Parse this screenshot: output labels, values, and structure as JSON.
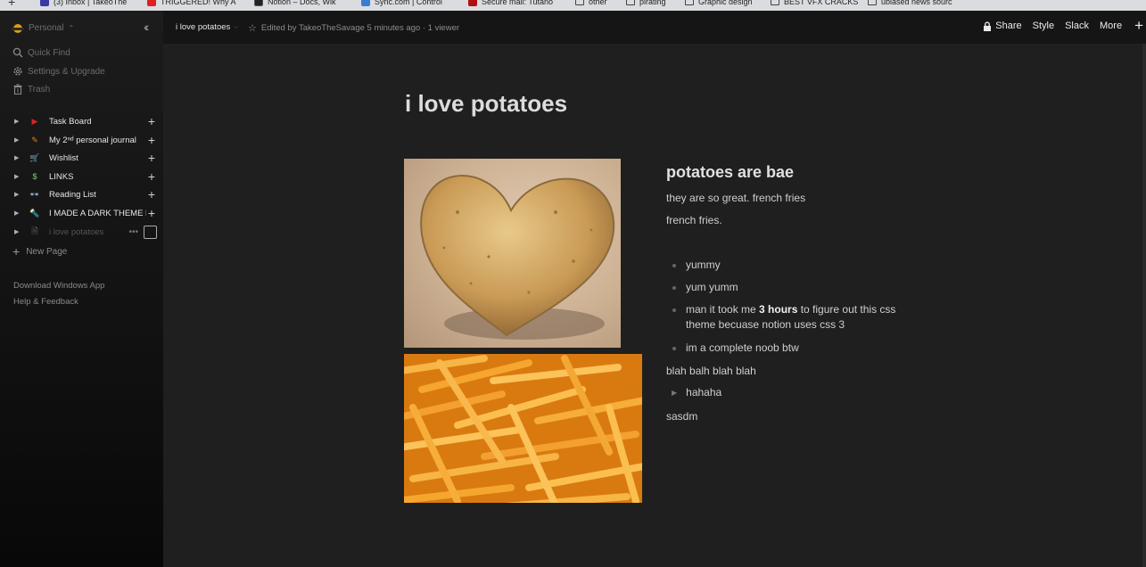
{
  "bookmarks": [
    {
      "label": "(3) Inbox | TakeoThe",
      "color": "#3a3aa0"
    },
    {
      "label": "TRIGGERED! Why A",
      "color": "#e02020"
    },
    {
      "label": "Notion – Docs, Wik",
      "color": "#222222"
    },
    {
      "label": "Sync.com | Control",
      "color": "#3a7bd5"
    },
    {
      "label": "Secure mail: Tutano",
      "color": "#b01010"
    },
    {
      "label": "other",
      "folder": true
    },
    {
      "label": "pirating",
      "folder": true
    },
    {
      "label": "Graphic design",
      "folder": true
    },
    {
      "label": "BEST VFX CRACKS",
      "folder": true
    },
    {
      "label": "ubiased news sourc",
      "folder": true
    }
  ],
  "sidebar": {
    "workspace": "Personal",
    "workspace_caret": "⌃",
    "nav": [
      {
        "label": "Quick Find",
        "icon": "search-icon"
      },
      {
        "label": "Settings & Upgrade",
        "icon": "gear-icon"
      },
      {
        "label": "Trash",
        "icon": "trash-icon"
      }
    ],
    "pages": [
      {
        "label": "Task Board",
        "icon": "▶",
        "icon_color": "#e02020"
      },
      {
        "label": "My 2ⁿᵈ personal journal",
        "icon": "✎",
        "icon_color": "#e0812a"
      },
      {
        "label": "Wishlist",
        "icon": "🛒",
        "icon_color": "#cccccc"
      },
      {
        "label": "LINKS",
        "icon": "$",
        "icon_color": "#7fcf6a"
      },
      {
        "label": "Reading List",
        "icon": "👓",
        "icon_color": "#4aa8e0"
      },
      {
        "label": "I MADE A DARK THEME F",
        "icon": "🔦",
        "icon_color": "#e0c04a"
      },
      {
        "label": "i love potatoes",
        "icon": "🗎",
        "icon_color": "#888888"
      }
    ],
    "new_page": "New Page",
    "footer": [
      "Download Windows App",
      "Help & Feedback"
    ]
  },
  "topbar": {
    "breadcrumb": "i love potatoes",
    "edited": "Edited by TakeoTheSavage 5 minutes ago · 1 viewer",
    "share": "Share",
    "style": "Style",
    "slack": "Slack",
    "more": "More"
  },
  "content": {
    "title": "i love potatoes",
    "heading": "potatoes are bae",
    "para1": "they are so great. french fries",
    "para2": "french fries.",
    "bullets": [
      {
        "before": "yummy",
        "bold": "",
        "after": ""
      },
      {
        "before": "yum yumm",
        "bold": "",
        "after": ""
      },
      {
        "before": "man it took me ",
        "bold": "3 hours",
        "after": " to figure out this css theme becuase notion uses css 3"
      },
      {
        "before": "im a complete noob btw",
        "bold": "",
        "after": ""
      }
    ],
    "para3": "blah balh blah blah",
    "toggle": "hahaha",
    "para4": "sasdm"
  }
}
